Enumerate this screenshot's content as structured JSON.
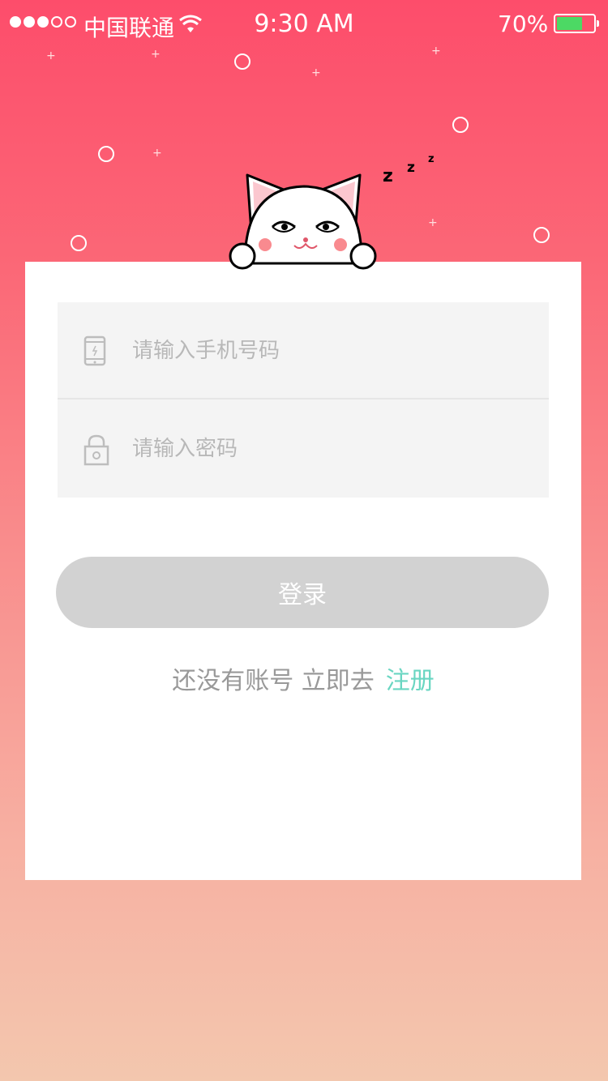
{
  "status_bar": {
    "carrier": "中国联通",
    "time": "9:30 AM",
    "battery_percent": "70%",
    "signal_bars_filled": 3,
    "signal_bars_total": 5,
    "battery_level": 0.7,
    "battery_color": "#4cd964"
  },
  "login_form": {
    "phone_placeholder": "请输入手机号码",
    "phone_value": "",
    "phone_icon": "mobile-phone-icon",
    "password_placeholder": "请输入密码",
    "password_value": "",
    "password_icon": "lock-icon",
    "login_label": "登录",
    "no_account_text": "还没有账号 立即去",
    "register_label": "注册"
  },
  "colors": {
    "background_top": "#fd4d6b",
    "background_bottom": "#f3c7ae",
    "button_disabled": "#d2d2d2",
    "link": "#6ad6c2"
  }
}
